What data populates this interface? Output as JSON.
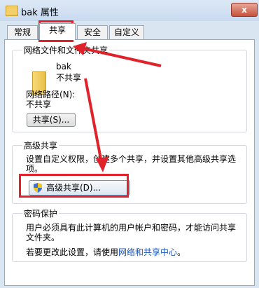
{
  "window": {
    "title": "bak 属性",
    "close_label": "x"
  },
  "tabs": [
    {
      "label": "常规",
      "active": false
    },
    {
      "label": "共享",
      "active": true
    },
    {
      "label": "安全",
      "active": false
    },
    {
      "label": "自定义",
      "active": false
    }
  ],
  "network_sharing": {
    "group_title": "网络文件和文件夹共享",
    "folder_name": "bak",
    "folder_status": "不共享",
    "path_label": "网络路径(N):",
    "path_value": "不共享",
    "share_button": "共享(S)..."
  },
  "advanced_sharing": {
    "group_title": "高级共享",
    "description_line1": "设置自定义权限，创建多个共享，并设置其他高级共享选",
    "description_line2": "项。",
    "button": "高级共享(D)..."
  },
  "password_protection": {
    "group_title": "密码保护",
    "description_line1": "用户必须具有此计算机的用户帐户和密码，才能访问共享",
    "description_line2": "文件夹。",
    "change_prefix": "若要更改此设置，请使用",
    "change_link": "网络和共享中心",
    "change_suffix": "。"
  },
  "colors": {
    "highlight": "#e0232a",
    "link": "#1a56b7",
    "panel_border": "#9aa7b5"
  }
}
